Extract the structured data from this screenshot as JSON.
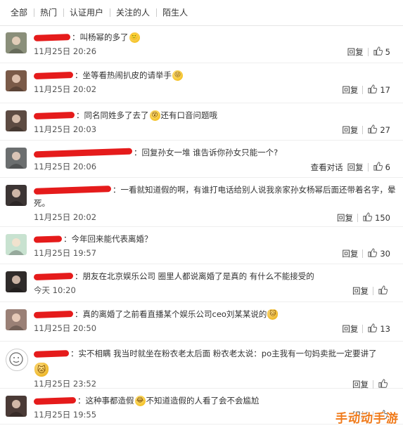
{
  "tabs": [
    "全部",
    "热门",
    "认证用户",
    "关注的人",
    "陌生人"
  ],
  "comments": [
    {
      "text_before": "：叫杨幂的多了",
      "emoji": "🙂",
      "text_after": "",
      "time": "11月25日 20:26",
      "reply": "回复",
      "likes": "5",
      "avatar_color": "#8a8f7a"
    },
    {
      "text_before": "：坐等看热闹扒皮的请举手",
      "emoji": "😝",
      "text_after": "",
      "time": "11月25日 20:02",
      "reply": "回复",
      "likes": "17",
      "avatar_color": "#7a5a48"
    },
    {
      "text_before": "：同名同姓多了去了",
      "emoji": "😵",
      "text_after": "还有口音问题哦",
      "time": "11月25日 20:03",
      "reply": "回复",
      "likes": "27",
      "avatar_color": "#5d4b42"
    },
    {
      "text_before": "：回复",
      "emoji": "",
      "text_after": "孙女一堆 谁告诉你孙女只能一个?",
      "time": "11月25日 20:06",
      "reply": "查看对话",
      "reply2": "回复",
      "likes": "6",
      "avatar_color": "#6b6e6f"
    },
    {
      "text_before": "：一看就知道假的啊，有谁打电话给别人说我亲家孙女杨幂后面还带着名字，晕",
      "emoji": "",
      "text_after": "死。",
      "time": "11月25日 20:02",
      "reply": "回复",
      "likes": "150",
      "avatar_color": "#3c3534"
    },
    {
      "text_before": "：今年回来能代表离婚？",
      "emoji": "",
      "text_after": "",
      "time": "11月25日 19:57",
      "reply": "回复",
      "likes": "30",
      "avatar_color": "#c8e2d0"
    },
    {
      "text_before": "：朋友在北京娱乐公司 圈里人都说离婚了是真的 有什么不能接受的",
      "emoji": "",
      "text_after": "",
      "time": "今天 10:20",
      "reply": "回复",
      "likes": "",
      "avatar_color": "#2f2b2a"
    },
    {
      "text_before": "：真的离婚了之前看直播某个娱乐公司ceo刘某某说的",
      "emoji": "🐱",
      "text_after": "",
      "time": "11月25日 20:50",
      "reply": "回复",
      "likes": "13",
      "avatar_color": "#9a8076"
    },
    {
      "text_before": "：实不相瞒 我当时就坐在粉衣老太后面 粉衣老太说：po主我有一句妈卖批一定要讲了",
      "emoji": "🐱",
      "text_after": "",
      "time": "11月25日 23:52",
      "reply": "回复",
      "likes": "",
      "avatar_color": "#ffffff"
    },
    {
      "text_before": "：这种事都造假",
      "emoji": "😂",
      "text_after": "不知道造假的人看了会不会尴尬",
      "time": "11月25日 19:55",
      "reply": "回复",
      "likes": "",
      "avatar_color": "#4a3a36"
    }
  ],
  "watermark": "手动动手游",
  "colors": {
    "redact": "#e51b1b",
    "watermark": "#f07a1a"
  }
}
